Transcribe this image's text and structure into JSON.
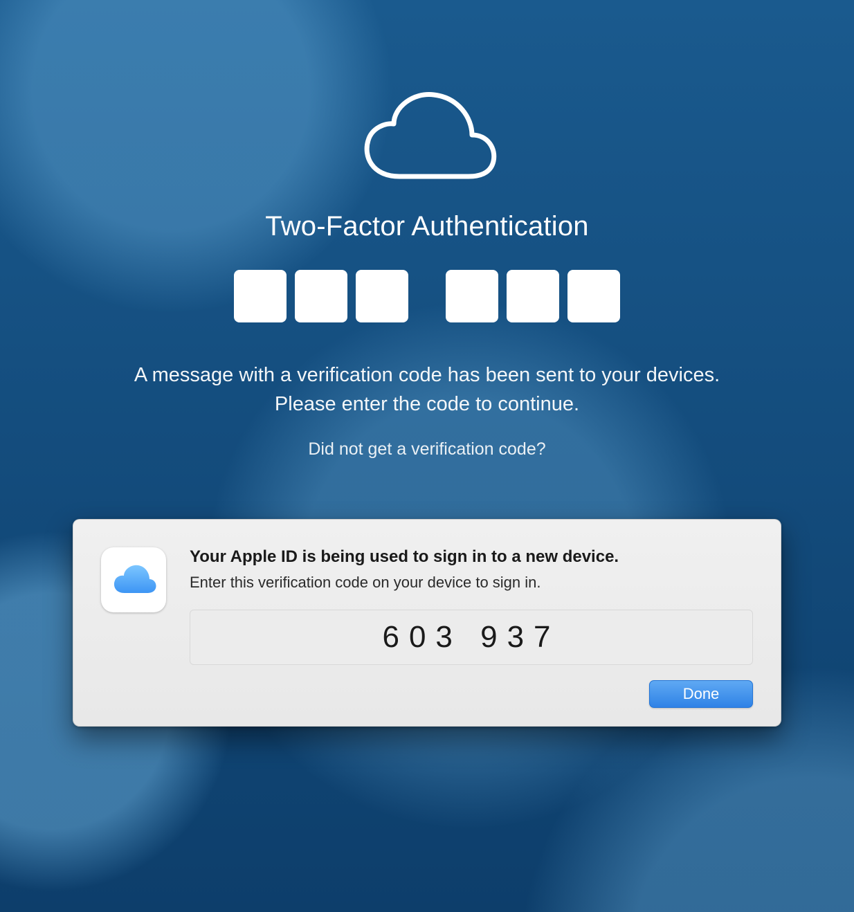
{
  "main": {
    "title": "Two-Factor Authentication",
    "code_inputs": [
      "",
      "",
      "",
      "",
      "",
      ""
    ],
    "instruction": "A message with a verification code has been sent to your devices. Please enter the code to continue.",
    "resend_link": "Did not get a verification code?"
  },
  "dialog": {
    "title": "Your Apple ID is being used to sign in to a new device.",
    "subtitle": "Enter this verification code on your device to sign in.",
    "verification_code": "603 937",
    "done_label": "Done"
  },
  "icons": {
    "cloud_outline": "cloud-icon",
    "icloud_app": "icloud-app-icon"
  }
}
